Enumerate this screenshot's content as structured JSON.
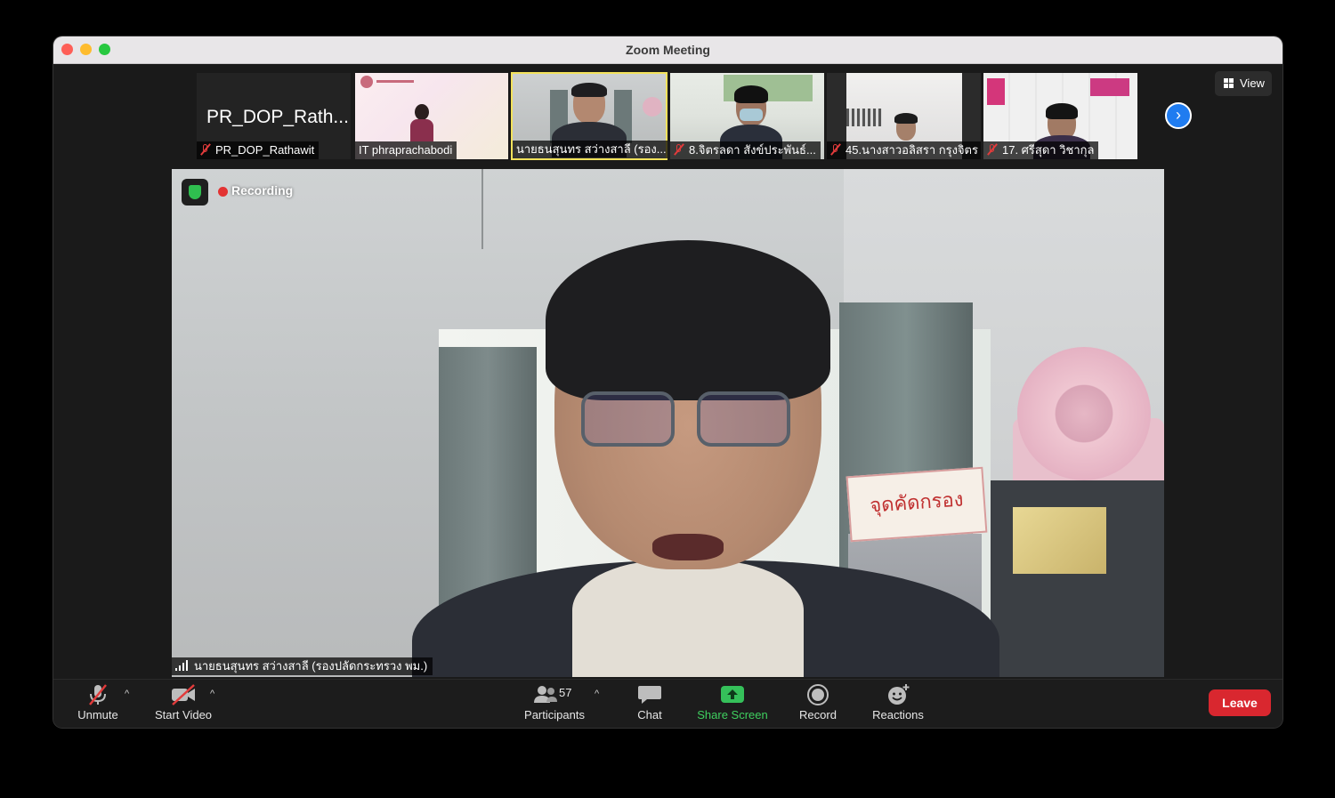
{
  "window": {
    "title": "Zoom Meeting"
  },
  "view": {
    "label": "View"
  },
  "participants_strip": [
    {
      "display_name": "PR_DOP_Rath...",
      "name": "PR_DOP_Rathawit",
      "muted": true
    },
    {
      "name": "IT phraprachabodi",
      "muted": false
    },
    {
      "name": "นายธนสุนทร สว่างสาลี (รอง...",
      "muted": false,
      "active": true
    },
    {
      "name": "8.จิตรลดา สังข์ประพันธ์...",
      "muted": true
    },
    {
      "name": "45.นางสาวอลิสรา กรุงจิตร",
      "muted": true
    },
    {
      "name": "17. ศรีสุดา  วิชากุล",
      "muted": true
    }
  ],
  "main_video": {
    "recording_label": "Recording",
    "speaker_name": "นายธนสุนทร สว่างสาลี (รองปลัดกระทรวง พม.)",
    "sign_text": "จุดคัดกรอง"
  },
  "toolbar": {
    "unmute": "Unmute",
    "start_video": "Start Video",
    "participants": "Participants",
    "participants_count": "57",
    "chat": "Chat",
    "share_screen": "Share Screen",
    "record": "Record",
    "reactions": "Reactions",
    "leave": "Leave"
  },
  "colors": {
    "accent_blue": "#1f7cf0",
    "leave_red": "#d9272f",
    "share_green": "#3fcf5f",
    "active_border": "#f3e25b"
  }
}
